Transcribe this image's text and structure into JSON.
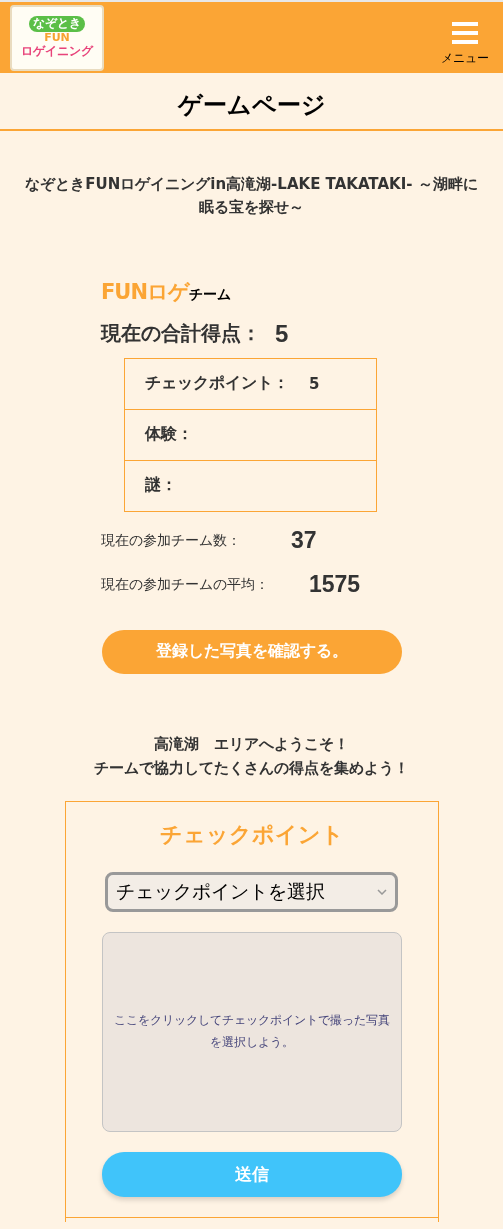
{
  "header": {
    "logo": {
      "tag": "なぞとき",
      "top": "FUN",
      "bottom": "ロゲイニング"
    },
    "menu_label": "メニュー"
  },
  "page_title": "ゲームページ",
  "event_title": "なぞときFUNロゲイニングin高滝湖-LAKE TAKATAKI- ～湖畔に眠る宝を探せ～",
  "team": {
    "name_accent": "FUNロゲ",
    "name_suffix": "チーム"
  },
  "total": {
    "label": "現在の合計得点：",
    "value": "5"
  },
  "breakdown": [
    {
      "label": "チェックポイント：",
      "value": "5"
    },
    {
      "label": "体験："
    },
    {
      "label": "謎："
    }
  ],
  "stats": [
    {
      "label": "現在の参加チーム数：",
      "value": "37"
    },
    {
      "label": "現在の参加チームの平均：",
      "value": "1575"
    }
  ],
  "photos_button": "登録した写真を確認する。",
  "welcome": [
    "高滝湖　エリアへようこそ！",
    "チームで協力してたくさんの得点を集めよう！"
  ],
  "checkpoint_card": {
    "title": "チェックポイント",
    "select_placeholder": "チェックポイントを選択",
    "upload_hint": "ここをクリックしてチェックポイントで撮った写真を選択しよう。",
    "submit": "送信"
  }
}
